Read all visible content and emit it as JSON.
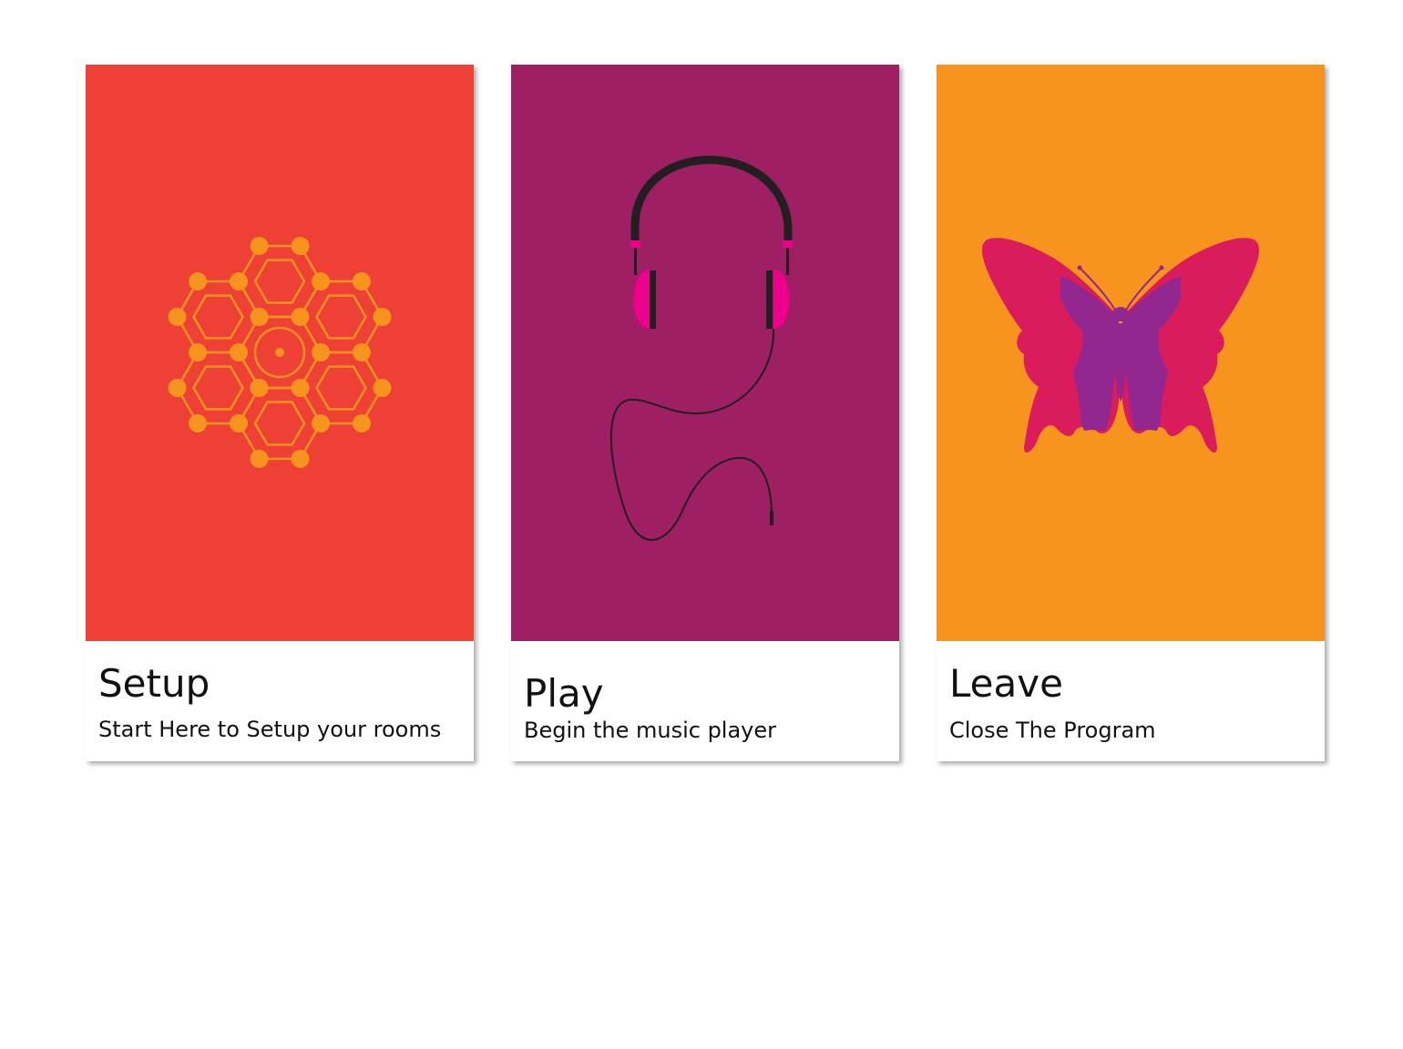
{
  "tiles": [
    {
      "id": "setup",
      "title": "Setup",
      "subtitle": "Start Here to Setup your rooms",
      "icon": "hexagon-cluster-icon",
      "color": "#ef4036"
    },
    {
      "id": "play",
      "title": "Play",
      "subtitle": "Begin the music player",
      "icon": "headphones-icon",
      "color": "#9e1f63"
    },
    {
      "id": "leave",
      "title": "Leave",
      "subtitle": "Close The Program",
      "icon": "butterfly-icon",
      "color": "#f7941d"
    }
  ]
}
